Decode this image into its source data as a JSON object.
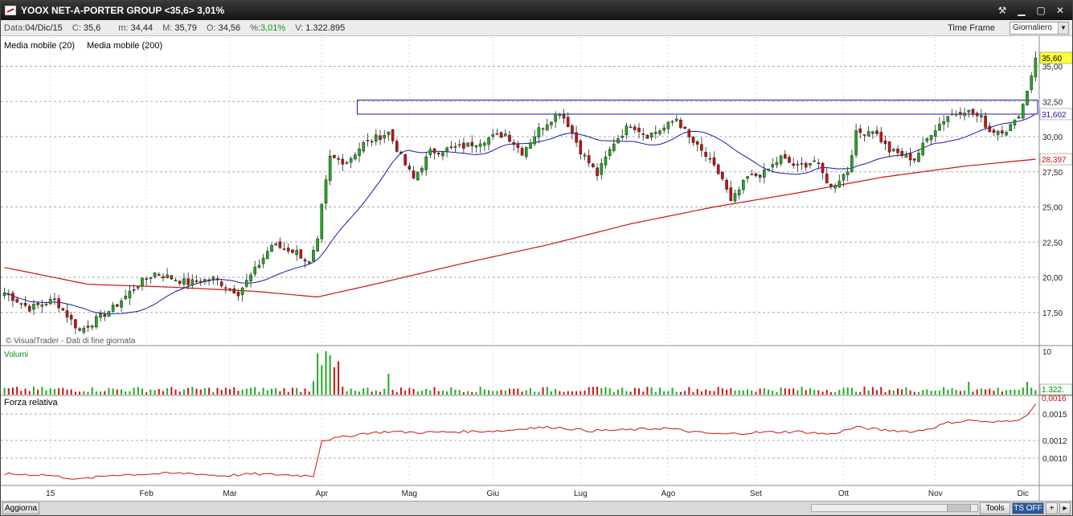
{
  "window": {
    "title": "YOOX NET-A-PORTER GROUP <35,6> 3,01%",
    "controls": [
      "tools-icon",
      "minimize-icon",
      "maximize-icon",
      "close-icon"
    ]
  },
  "infobar": {
    "data_label": "Data:",
    "data_value": "04/Dic/15",
    "close_label": "C:",
    "close_value": "35,6",
    "min_label": "m:",
    "min_value": "34,44",
    "max_label": "M:",
    "max_value": "35,79",
    "open_label": "O:",
    "open_value": "34,56",
    "pct_label": "%:",
    "pct_value": "3,01%",
    "vol_label": "V:",
    "vol_value": "1.322.895",
    "timeframe_label": "Time Frame",
    "timeframe_value": "Giornaliero"
  },
  "legend": {
    "ma20": "Media mobile (20)",
    "ma200": "Media mobile (200)",
    "copyright": "© VisualTrader - Dati di fine giornata",
    "volume": "Volumi",
    "rs": "Forza relativa"
  },
  "colors": {
    "ma20": "#1a1aa6",
    "ma200": "#cc1111",
    "up": "#22aa22",
    "down": "#cc1111",
    "rs_line": "#cc1111",
    "price_badge": "#ffff33"
  },
  "price_badges": {
    "last": "35,60",
    "ma20": "31,602",
    "ma200": "28,397"
  },
  "volume_badge": "1.322.",
  "volume_axis_top": "10",
  "rs_badge": "0,0016",
  "statusbar": {
    "refresh": "Aggiorna",
    "tools": "Tools",
    "ts": "TS OFF",
    "plus": "+",
    "arrow": "▸"
  },
  "chart_data": [
    {
      "type": "candlestick",
      "title": "YOOX NET-A-PORTER GROUP",
      "y_ticks": [
        "17,50",
        "20,00",
        "22,50",
        "25,00",
        "27,50",
        "30,00",
        "32,50",
        "35,00"
      ],
      "ylim": [
        15.2,
        36.8
      ],
      "x_ticks": [
        "15",
        "Feb",
        "Mar",
        "Apr",
        "Mag",
        "Giu",
        "Lug",
        "Ago",
        "Set",
        "Ott",
        "Nov",
        "Dic"
      ],
      "x_tick_day_index": [
        11,
        34,
        54,
        76,
        97,
        117,
        138,
        159,
        180,
        201,
        223,
        244
      ],
      "n_days": 248,
      "keypoints_close": [
        [
          0,
          18.9
        ],
        [
          6,
          17.8
        ],
        [
          12,
          18.4
        ],
        [
          18,
          16.2
        ],
        [
          26,
          17.8
        ],
        [
          32,
          19.5
        ],
        [
          36,
          20.3
        ],
        [
          44,
          19.6
        ],
        [
          50,
          19.9
        ],
        [
          56,
          18.9
        ],
        [
          60,
          20.5
        ],
        [
          64,
          22.3
        ],
        [
          70,
          21.8
        ],
        [
          73,
          21.0
        ],
        [
          75,
          22.5
        ],
        [
          76,
          25.0
        ],
        [
          78,
          28.5
        ],
        [
          82,
          28.2
        ],
        [
          86,
          29.5
        ],
        [
          92,
          30.3
        ],
        [
          96,
          28.0
        ],
        [
          98,
          27.0
        ],
        [
          102,
          28.9
        ],
        [
          110,
          29.3
        ],
        [
          116,
          29.9
        ],
        [
          120,
          30.2
        ],
        [
          124,
          28.9
        ],
        [
          128,
          30.5
        ],
        [
          133,
          31.8
        ],
        [
          135,
          30.9
        ],
        [
          138,
          29.0
        ],
        [
          142,
          27.3
        ],
        [
          146,
          29.6
        ],
        [
          150,
          30.9
        ],
        [
          154,
          30.1
        ],
        [
          158,
          30.6
        ],
        [
          161,
          31.3
        ],
        [
          164,
          29.9
        ],
        [
          168,
          28.6
        ],
        [
          172,
          27.0
        ],
        [
          174,
          25.3
        ],
        [
          178,
          27.1
        ],
        [
          182,
          27.4
        ],
        [
          186,
          28.5
        ],
        [
          190,
          27.8
        ],
        [
          194,
          28.3
        ],
        [
          198,
          26.4
        ],
        [
          202,
          27.6
        ],
        [
          204,
          30.2
        ],
        [
          208,
          30.5
        ],
        [
          212,
          29.0
        ],
        [
          218,
          28.4
        ],
        [
          222,
          30.3
        ],
        [
          226,
          31.5
        ],
        [
          230,
          31.9
        ],
        [
          234,
          31.3
        ],
        [
          236,
          30.4
        ],
        [
          240,
          30.5
        ],
        [
          242,
          31.0
        ],
        [
          244,
          32.3
        ],
        [
          246,
          34.4
        ],
        [
          247,
          35.6
        ]
      ],
      "ma20_last": 31.602,
      "ma200_keypoints": [
        [
          0,
          20.7
        ],
        [
          20,
          19.5
        ],
        [
          40,
          19.3
        ],
        [
          60,
          19.0
        ],
        [
          75,
          18.6
        ],
        [
          90,
          19.6
        ],
        [
          110,
          21.0
        ],
        [
          130,
          22.3
        ],
        [
          150,
          23.8
        ],
        [
          170,
          25.0
        ],
        [
          190,
          26.0
        ],
        [
          210,
          27.1
        ],
        [
          230,
          27.9
        ],
        [
          247,
          28.397
        ]
      ],
      "box": {
        "x_from_day": 85,
        "x_to_day": 248,
        "y_low": 31.6,
        "y_high": 32.6
      }
    },
    {
      "type": "bar",
      "title": "Volumi",
      "last": "1.322.895"
    },
    {
      "type": "line",
      "title": "Forza relativa",
      "y_ticks": [
        "0,0010",
        "0,0012",
        "0,0015"
      ],
      "ylim": [
        0.0007,
        0.0017
      ],
      "keypoints": [
        [
          0,
          0.00082
        ],
        [
          10,
          0.00081
        ],
        [
          18,
          0.00076
        ],
        [
          26,
          0.00081
        ],
        [
          34,
          0.00082
        ],
        [
          44,
          0.00083
        ],
        [
          52,
          0.0008
        ],
        [
          60,
          0.00082
        ],
        [
          68,
          0.00081
        ],
        [
          74,
          0.0008
        ],
        [
          76,
          0.0012
        ],
        [
          80,
          0.00123
        ],
        [
          86,
          0.00128
        ],
        [
          92,
          0.0013
        ],
        [
          100,
          0.00129
        ],
        [
          110,
          0.0013
        ],
        [
          120,
          0.00131
        ],
        [
          125,
          0.00134
        ],
        [
          132,
          0.00135
        ],
        [
          140,
          0.00131
        ],
        [
          150,
          0.00132
        ],
        [
          158,
          0.00134
        ],
        [
          166,
          0.00129
        ],
        [
          172,
          0.00127
        ],
        [
          180,
          0.00129
        ],
        [
          190,
          0.0013
        ],
        [
          198,
          0.00127
        ],
        [
          204,
          0.00135
        ],
        [
          210,
          0.00132
        ],
        [
          218,
          0.0013
        ],
        [
          222,
          0.00134
        ],
        [
          226,
          0.0014
        ],
        [
          232,
          0.00143
        ],
        [
          236,
          0.0014
        ],
        [
          240,
          0.00142
        ],
        [
          244,
          0.00145
        ],
        [
          246,
          0.00155
        ],
        [
          247,
          0.00161
        ]
      ]
    }
  ]
}
